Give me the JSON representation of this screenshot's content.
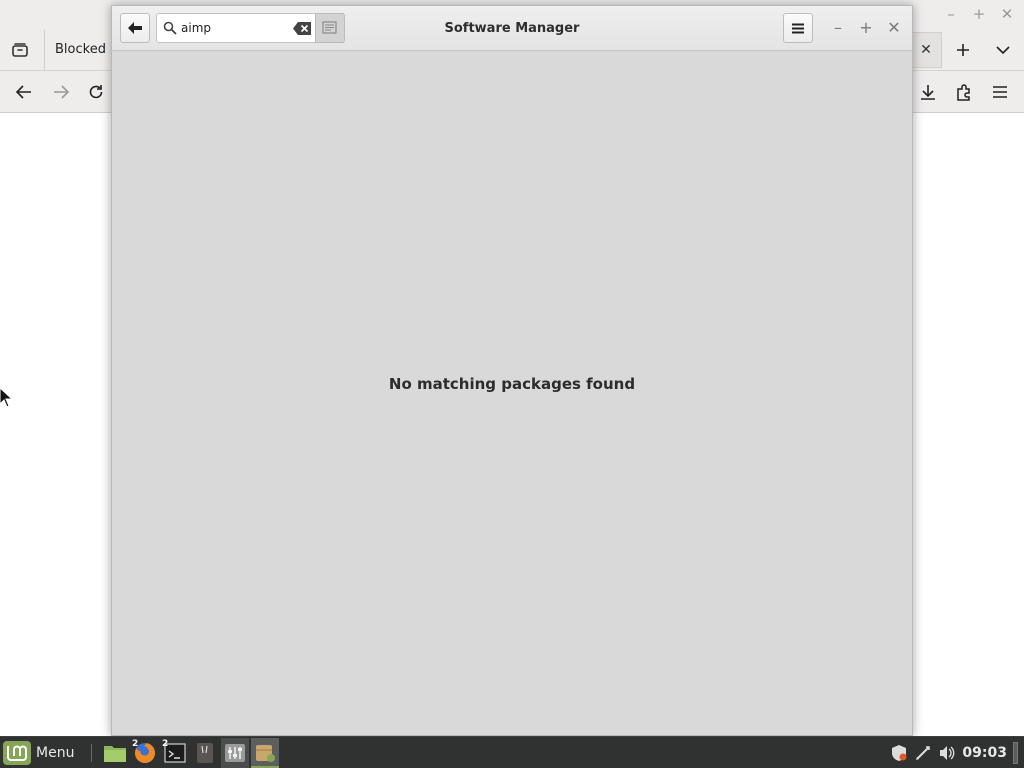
{
  "browser": {
    "tab_label": "Blocked"
  },
  "software_manager": {
    "title": "Software Manager",
    "search": {
      "value": "aimp",
      "placeholder": ""
    },
    "empty_message": "No matching packages found"
  },
  "taskbar": {
    "menu_label": "Menu",
    "badge_firefox": "2",
    "badge_terminal": "2",
    "clock": "09:03"
  },
  "colors": {
    "accent": "#87a556",
    "window_bg": "#d9d9d9",
    "taskbar_bg": "#2f3230"
  }
}
